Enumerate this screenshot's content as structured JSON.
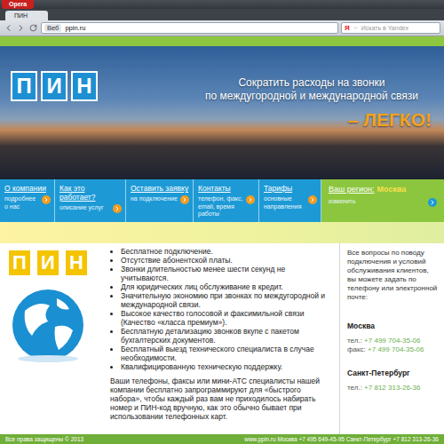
{
  "browser": {
    "menu_button": "Opera",
    "tab": {
      "label": "ПИН",
      "selected": true
    },
    "web_badge": "Веб",
    "url": "ppin.ru",
    "search": {
      "icon": "Я",
      "placeholder": "Искать в Yandex"
    }
  },
  "hero": {
    "logo": [
      "П",
      "И",
      "Н"
    ],
    "headline": [
      "Сократить расходы на звонки",
      "по междугородной и международной связи"
    ],
    "accent": "– ЛЕГКО!"
  },
  "nav": {
    "items": [
      {
        "title": "О компании",
        "subtitle": "подробнее о нас"
      },
      {
        "title": "Как это работает?",
        "subtitle": "описание услуг"
      },
      {
        "title": "Оставить заявку",
        "subtitle": "на подключение"
      },
      {
        "title": "Контакты",
        "subtitle": "телефон, факс, email, время работы"
      },
      {
        "title": "Тарифы",
        "subtitle": "основные направления"
      }
    ],
    "region": {
      "label": "Ваш регион:",
      "value": "Москва",
      "action": "изменить"
    }
  },
  "content": {
    "logo": [
      "П",
      "И",
      "Н"
    ],
    "features": [
      "Бесплатное подключение.",
      "Отсутствие абонентской платы.",
      "Звонки длительностью менее шести секунд не учитываются.",
      "Для юридических лиц обслуживание в кредит.",
      "Значительную экономию при звонках по междугородной и международной связи.",
      "Высокое качество голосовой и факсимильной связи (Качество «класса премиум»).",
      "Бесплатную детализацию звонков вкупе с пакетом бухгалтерских документов.",
      "Бесплатный выезд технического специалиста в случае необходимости.",
      "Квалифицированную техническую поддержку."
    ],
    "paragraph": "Ваши телефоны, факсы или мини-АТС специалисты нашей компании бесплатно запрограммируют для «быстрого набора», чтобы каждый раз вам не приходилось набирать номер и ПИН-код вручную, как это обычно бывает при использовании телефонных карт.",
    "contacts": {
      "intro": "Все вопросы по поводу подключения и условий обслуживания клиентов, вы можете задать по телефону или электронной почте:",
      "cities": [
        {
          "name": "Москва",
          "lines": [
            {
              "label": "тел.:",
              "value": "+7 499 704-35-06"
            },
            {
              "label": "факс:",
              "value": "+7 499 704-35-06"
            }
          ]
        },
        {
          "name": "Санкт-Петербург",
          "lines": [
            {
              "label": "тел.:",
              "value": "+7 812 313-26-36"
            }
          ]
        }
      ]
    }
  },
  "footer": {
    "copyright": "Все права защищены © 2013",
    "contacts": "www.ppin.ru Москва +7 495 649-45-95 Санкт-Петербург +7 812 313-26-36"
  }
}
